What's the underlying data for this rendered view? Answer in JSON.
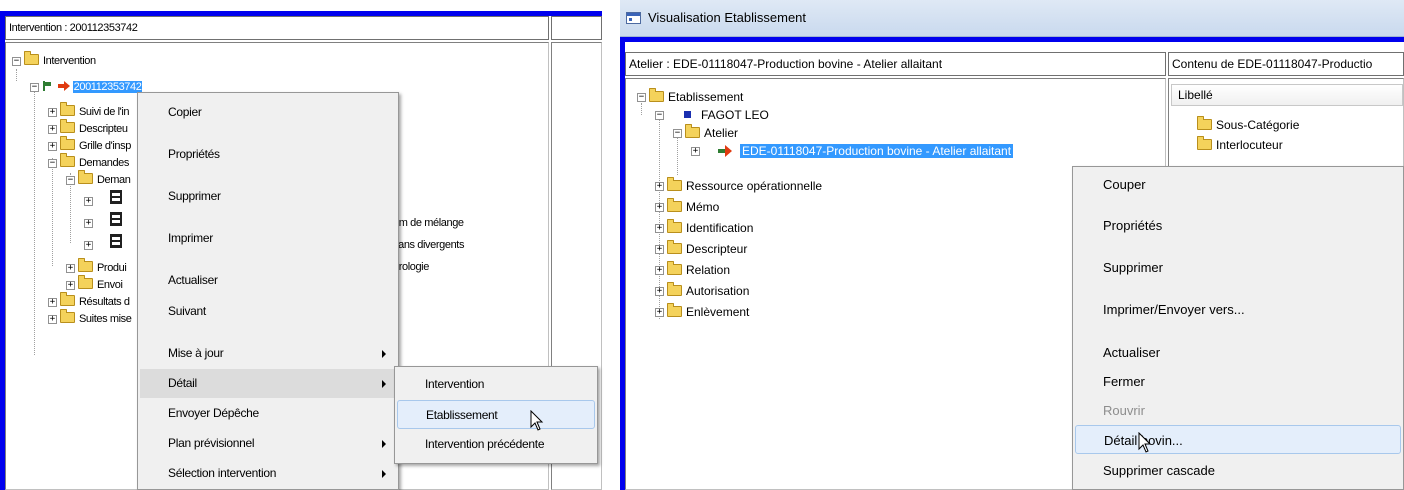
{
  "left": {
    "header_left": "Intervention : 200112353742",
    "tree": [
      {
        "label": "Intervention"
      },
      {
        "label": "200112353742"
      },
      {
        "label": "Suivi de l'in"
      },
      {
        "label": "Descripteu"
      },
      {
        "label": "Grille d'insp"
      },
      {
        "label": "Demandes"
      },
      {
        "label": "Deman"
      },
      {
        "label": "Produi"
      },
      {
        "label": "Envoi"
      },
      {
        "label": "Résultats d"
      },
      {
        "label": "Suites mise"
      }
    ],
    "behind_text": [
      "um de mélange",
      "sans divergents",
      "érologie"
    ],
    "context_menu": [
      {
        "label": "Copier"
      },
      {
        "label": "Propriétés"
      },
      {
        "label": "Supprimer"
      },
      {
        "label": "Imprimer"
      },
      {
        "label": "Actualiser"
      },
      {
        "label": "Suivant"
      },
      {
        "label": "Mise à jour"
      },
      {
        "label": "Détail"
      },
      {
        "label": "Envoyer Dépêche"
      },
      {
        "label": "Plan prévisionnel"
      },
      {
        "label": "Sélection intervention"
      }
    ],
    "submenu": [
      {
        "label": "Intervention"
      },
      {
        "label": "Etablissement"
      },
      {
        "label": "Intervention précédente"
      }
    ]
  },
  "right": {
    "window_title": "Visualisation Etablissement",
    "header_left": "Atelier : EDE-01118047-Production bovine - Atelier allaitant",
    "header_right": "Contenu de  EDE-01118047-Productio",
    "tree": [
      {
        "label": "Etablissement"
      },
      {
        "label": "FAGOT LEO"
      },
      {
        "label": "Atelier"
      },
      {
        "label": "EDE-01118047-Production bovine - Atelier allaitant"
      },
      {
        "label": "Ressource opérationnelle"
      },
      {
        "label": "Mémo"
      },
      {
        "label": "Identification"
      },
      {
        "label": "Descripteur"
      },
      {
        "label": "Relation"
      },
      {
        "label": "Autorisation"
      },
      {
        "label": "Enlèvement"
      }
    ],
    "list_header": "Libellé",
    "list_items": [
      {
        "label": "Sous-Catégorie"
      },
      {
        "label": "Interlocuteur"
      }
    ],
    "context_menu": [
      {
        "label": "Couper"
      },
      {
        "label": "Propriétés"
      },
      {
        "label": "Supprimer"
      },
      {
        "label": "Imprimer/Envoyer vers..."
      },
      {
        "label": "Actualiser"
      },
      {
        "label": "Fermer"
      },
      {
        "label": "Rouvrir"
      },
      {
        "label": "Détail bovin..."
      },
      {
        "label": "Supprimer cascade"
      }
    ]
  },
  "colors": {
    "frame_blue": "#0000ee",
    "selection": "#3399ff",
    "menu_bg": "#f0f0f0",
    "menu_highlight": "#e4eefb",
    "folder": "#f4d25b",
    "arrow_icon": "#e03a10"
  }
}
